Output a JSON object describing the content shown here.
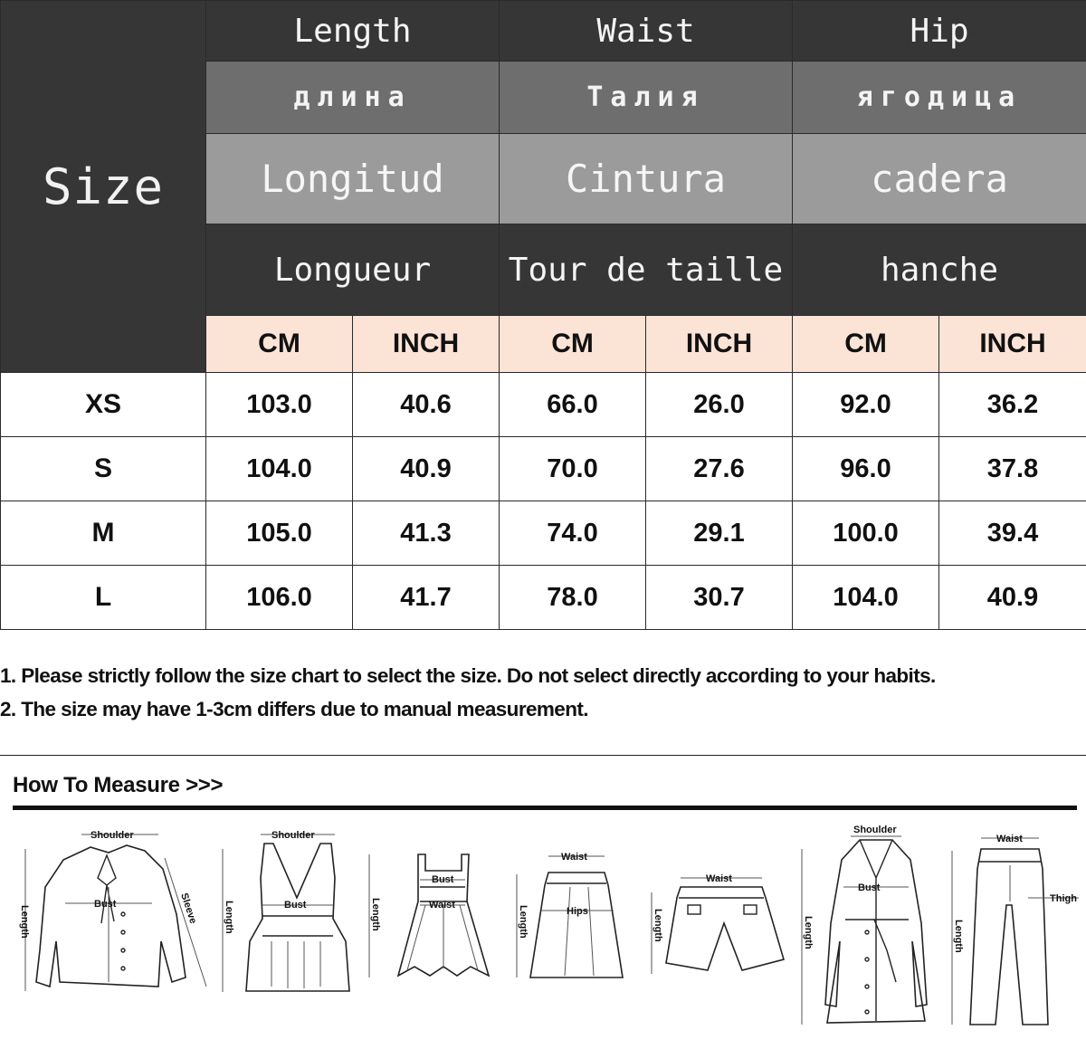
{
  "table": {
    "size_header": "Size",
    "columns": [
      {
        "en": "Length",
        "ru": "длина",
        "es": "Longitud",
        "fr": "Longueur"
      },
      {
        "en": "Waist",
        "ru": "Талия",
        "es": "Cintura",
        "fr": "Tour de taille"
      },
      {
        "en": "Hip",
        "ru": "ягодица",
        "es": "cadera",
        "fr": "hanche"
      }
    ],
    "units": [
      "CM",
      "INCH",
      "CM",
      "INCH",
      "CM",
      "INCH"
    ],
    "rows": [
      {
        "size": "XS",
        "values": [
          "103.0",
          "40.6",
          "66.0",
          "26.0",
          "92.0",
          "36.2"
        ]
      },
      {
        "size": "S",
        "values": [
          "104.0",
          "40.9",
          "70.0",
          "27.6",
          "96.0",
          "37.8"
        ]
      },
      {
        "size": "M",
        "values": [
          "105.0",
          "41.3",
          "74.0",
          "29.1",
          "100.0",
          "39.4"
        ]
      },
      {
        "size": "L",
        "values": [
          "106.0",
          "41.7",
          "78.0",
          "30.7",
          "104.0",
          "40.9"
        ]
      }
    ]
  },
  "notes": [
    "1. Please strictly follow the size chart to select the size. Do not select directly according to your habits.",
    "2. The size may have 1-3cm differs due to manual measurement."
  ],
  "how_to_measure": {
    "title": "How To Measure >>>",
    "labels": {
      "shoulder": "Shoulder",
      "bust": "Bust",
      "sleeve": "Sleeve",
      "length": "Length",
      "waist": "Waist",
      "hips": "Hips",
      "thigh": "Thigh"
    }
  }
}
